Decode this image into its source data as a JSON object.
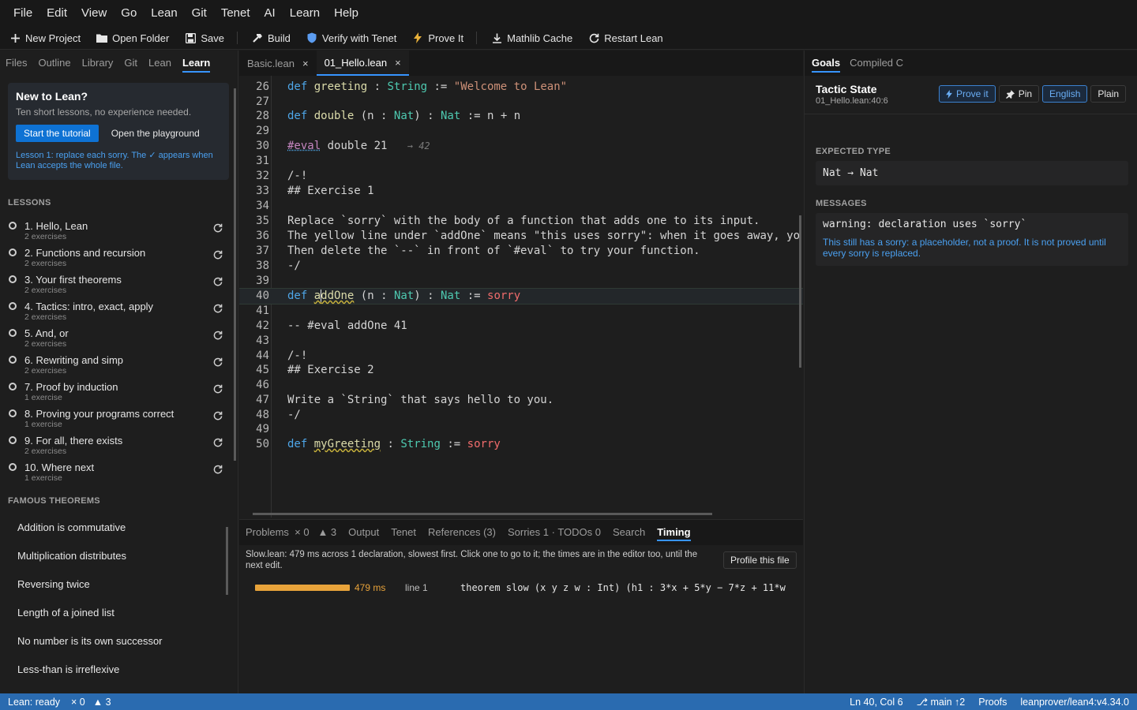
{
  "menu": [
    "File",
    "Edit",
    "View",
    "Go",
    "Lean",
    "Git",
    "Tenet",
    "AI",
    "Learn",
    "Help"
  ],
  "toolbar": {
    "new_project": "New Project",
    "open_folder": "Open Folder",
    "save": "Save",
    "build": "Build",
    "verify": "Verify with Tenet",
    "prove": "Prove It",
    "mathlib": "Mathlib Cache",
    "restart": "Restart Lean"
  },
  "sidebar": {
    "tabs": [
      "Files",
      "Outline",
      "Library",
      "Git",
      "Lean",
      "Learn"
    ],
    "active_tab": "Learn",
    "welcome": {
      "title": "New to Lean?",
      "subtitle": "Ten short lessons, no experience needed.",
      "start_button": "Start the tutorial",
      "playground_button": "Open the playground",
      "hint": "Lesson 1: replace each sorry. The ✓ appears when Lean accepts the whole file."
    },
    "lessons_header": "LESSONS",
    "lessons": [
      {
        "title": "1. Hello, Lean",
        "sub": "2 exercises"
      },
      {
        "title": "2. Functions and recursion",
        "sub": "2 exercises"
      },
      {
        "title": "3. Your first theorems",
        "sub": "2 exercises"
      },
      {
        "title": "4. Tactics: intro, exact, apply",
        "sub": "2 exercises"
      },
      {
        "title": "5. And, or",
        "sub": "2 exercises"
      },
      {
        "title": "6. Rewriting and simp",
        "sub": "2 exercises"
      },
      {
        "title": "7. Proof by induction",
        "sub": "1 exercise"
      },
      {
        "title": "8. Proving your programs correct",
        "sub": "1 exercise"
      },
      {
        "title": "9. For all, there exists",
        "sub": "2 exercises"
      },
      {
        "title": "10. Where next",
        "sub": "1 exercise"
      }
    ],
    "famous_header": "FAMOUS THEOREMS",
    "famous": [
      "Addition is commutative",
      "Multiplication distributes",
      "Reversing twice",
      "Length of a joined list",
      "No number is its own successor",
      "Less-than is irreflexive"
    ]
  },
  "editor": {
    "tabs": [
      {
        "label": "Basic.lean",
        "close": "×"
      },
      {
        "label": "01_Hello.lean",
        "close": "×"
      }
    ],
    "active_tab": "01_Hello.lean",
    "lines": {
      "n26": "26",
      "n27": "27",
      "n28": "28",
      "n29": "29",
      "n30": "30",
      "n31": "31",
      "n32": "32",
      "n33": "33",
      "n34": "34",
      "n35": "35",
      "n36": "36",
      "n37": "37",
      "n38": "38",
      "n39": "39",
      "n40": "40",
      "n41": "41",
      "n42": "42",
      "n43": "43",
      "n44": "44",
      "n45": "45",
      "n46": "46",
      "n47": "47",
      "n48": "48",
      "n49": "49",
      "n50": "50"
    },
    "code": {
      "kw_def": "def",
      "greeting_name": "greeting",
      "colon": ":",
      "string_ty": "String",
      "assign": ":=",
      "greeting_val": "\"Welcome to Lean\"",
      "double_name": "double",
      "double_params_open": "(n",
      "nat_ty": "Nat",
      "paren_close": ")",
      "double_body": "n + n",
      "eval_kw": "#eval",
      "eval_expr": "double 21",
      "eval_result": "→ 42",
      "doc_open": "/-!",
      "ex1_heading": "## Exercise 1",
      "line35": "Replace `sorry` with the body of a function that adds one to its input.",
      "line36": "The yellow line under `addOne` means \"this uses sorry\": when it goes away, yo",
      "line37": "Then delete the `--` in front of `#eval` to try your function.",
      "doc_close": "-/",
      "addone_a": "a",
      "addone_rest": "ddOne",
      "sorry": "sorry",
      "line42": "-- #eval addOne 41",
      "ex2_heading": "## Exercise 2",
      "line47": "Write a `String` that says hello to you.",
      "mygreeting_name": "myGreeting"
    }
  },
  "panel": {
    "tabs": {
      "problems": "Problems",
      "problems_err": "× 0",
      "problems_warn": "▲ 3",
      "output": "Output",
      "tenet": "Tenet",
      "references": "References (3)",
      "sorries": "Sorries 1 · TODOs 0",
      "search": "Search",
      "timing": "Timing"
    },
    "message": "Slow.lean: 479 ms across 1 declaration, slowest first. Click one to go to it; the times are in the editor too, until the next edit.",
    "profile_button": "Profile this file",
    "timing": {
      "ms": "479 ms",
      "line": "line 1",
      "sig": "theorem slow (x y z w : Int) (h1 : 3*x + 5*y − 7*z + 11*w"
    }
  },
  "goals": {
    "tabs": [
      "Goals",
      "Compiled C"
    ],
    "active_tab": "Goals",
    "title": "Tactic State",
    "location": "01_Hello.lean:40:6",
    "buttons": {
      "prove": "Prove it",
      "pin": "Pin",
      "english": "English",
      "plain": "Plain"
    },
    "expected_header": "EXPECTED TYPE",
    "expected_type": "Nat → Nat",
    "messages_header": "MESSAGES",
    "warning": "warning: declaration uses `sorry`",
    "explanation": "This still has a sorry: a placeholder, not a proof. It is not proved until every sorry is replaced."
  },
  "status": {
    "lean": "Lean: ready",
    "errors": "× 0",
    "warnings": "▲ 3",
    "position": "Ln 40, Col 6",
    "branch": "⎇ main ↑2",
    "proofs": "Proofs",
    "toolchain": "leanprover/lean4:v4.34.0"
  },
  "colors": {
    "accent": "#3794ff",
    "statusbar": "#2a6bb0",
    "timing_bar": "#e8a33a",
    "sorry": "#f06c6c"
  },
  "icons": {
    "new_project": "plus-icon",
    "open_folder": "folder-icon",
    "save": "save-icon",
    "build": "hammer-icon",
    "verify": "shield-icon",
    "prove": "bolt-icon",
    "mathlib": "download-icon",
    "restart": "restart-icon",
    "lesson_reset": "reset-icon",
    "pin": "pin-icon"
  },
  "timing_fraction": 1.0
}
